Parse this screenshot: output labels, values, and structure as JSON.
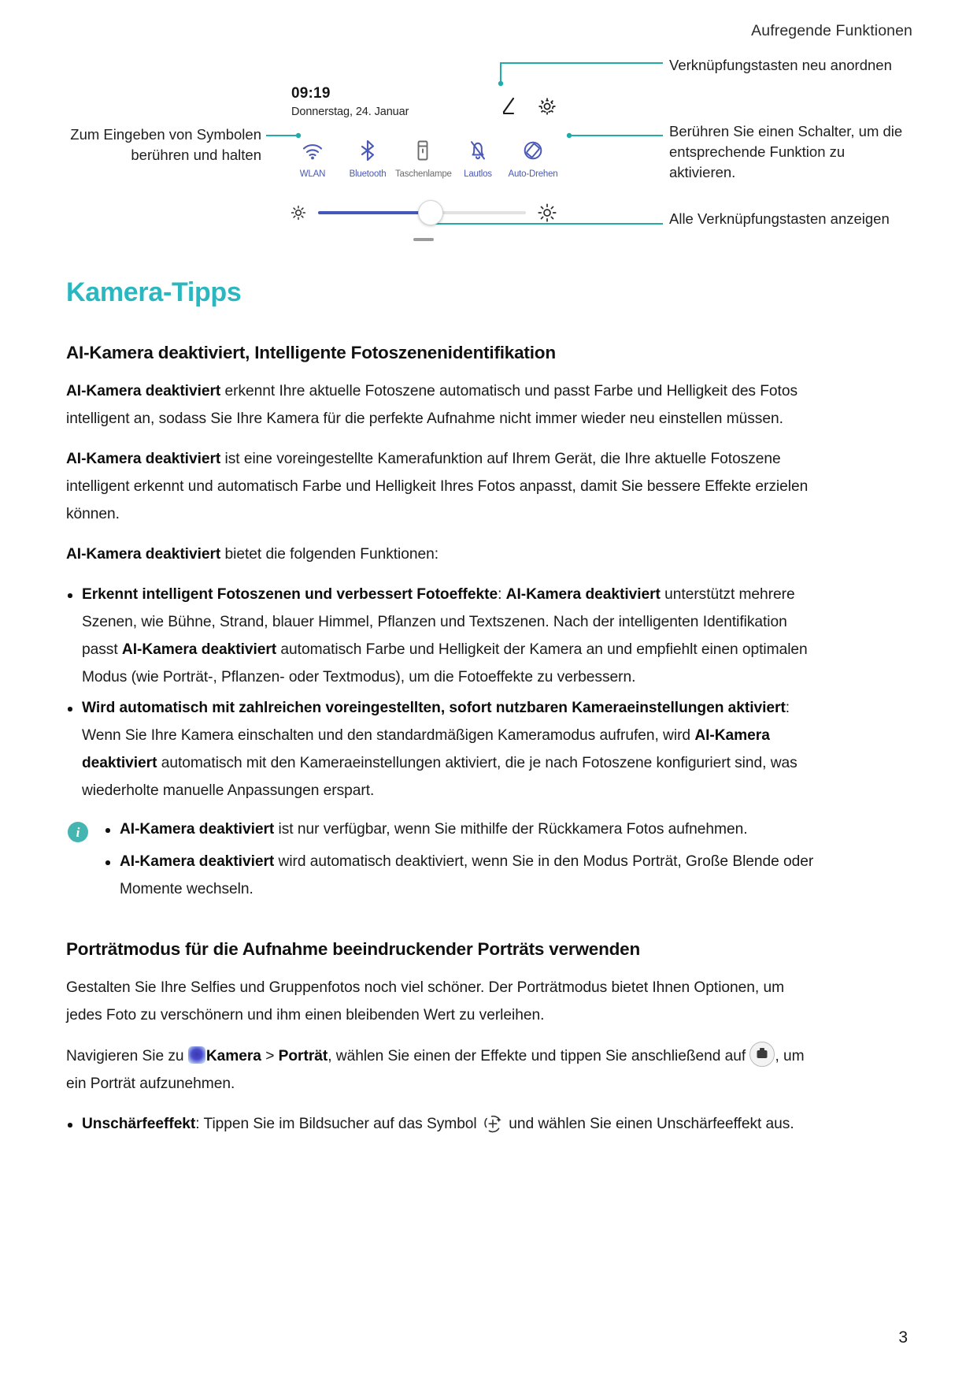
{
  "header": {
    "running_title": "Aufregende Funktionen"
  },
  "figure": {
    "panel": {
      "time": "09:19",
      "date": "Donnerstag, 24. Januar",
      "edit_icon": "pencil-edit-icon",
      "settings_icon": "gear-icon",
      "toggles": [
        {
          "icon": "wifi-icon",
          "label": "WLAN",
          "state": "on"
        },
        {
          "icon": "bluetooth-icon",
          "label": "Bluetooth",
          "state": "on"
        },
        {
          "icon": "flashlight-icon",
          "label": "Taschenlampe",
          "state": "off"
        },
        {
          "icon": "bell-mute-icon",
          "label": "Lautlos",
          "state": "on"
        },
        {
          "icon": "auto-rotate-icon",
          "label": "Auto-Drehen",
          "state": "on"
        }
      ],
      "brightness": {
        "low_icon": "sun-small-icon",
        "high_icon": "sun-large-icon",
        "value_percent": 54
      },
      "expand_handle": "drag-handle"
    },
    "callouts": {
      "left": "Zum Eingeben von Symbolen berühren und halten",
      "right_top": "Verknüpfungstasten neu anordnen",
      "right_middle": "Berühren Sie einen Schalter, um die entsprechende Funktion zu aktivieren.",
      "right_bottom": "Alle Verknüpfungstasten anzeigen"
    }
  },
  "content": {
    "section_title": "Kamera-Tipps",
    "subsection_1": {
      "title": "AI-Kamera deaktiviert, Intelligente Fotoszenenidentifikation",
      "p1_bold": "AI-Kamera deaktiviert",
      "p1_rest": " erkennt Ihre aktuelle Fotoszene automatisch und passt Farbe und Helligkeit des Fotos intelligent an, sodass Sie Ihre Kamera für die perfekte Aufnahme nicht immer wieder neu einstellen müssen.",
      "p2_bold": "AI-Kamera deaktiviert",
      "p2_rest": " ist eine voreingestellte Kamerafunktion auf Ihrem Gerät, die Ihre aktuelle Fotoszene intelligent erkennt und automatisch Farbe und Helligkeit Ihres Fotos anpasst, damit Sie bessere Effekte erzielen können.",
      "p3_bold": "AI-Kamera deaktiviert",
      "p3_rest": " bietet die folgenden Funktionen:",
      "bullet_1": {
        "lead_bold": "Erkennt intelligent Fotoszenen und verbessert Fotoeffekte",
        "colon": ": ",
        "mid_bold_1": "AI-Kamera deaktiviert",
        "text_1": " unterstützt mehrere Szenen, wie Bühne, Strand, blauer Himmel, Pflanzen und Textszenen. Nach der intelligenten Identifikation passt ",
        "mid_bold_2": "AI-Kamera deaktiviert",
        "text_2": " automatisch Farbe und Helligkeit der Kamera an und empfiehlt einen optimalen Modus (wie Porträt-, Pflanzen- oder Textmodus), um die Fotoeffekte zu verbessern."
      },
      "bullet_2": {
        "lead_bold": "Wird automatisch mit zahlreichen voreingestellten, sofort nutzbaren Kameraeinstellungen aktiviert",
        "colon": ": ",
        "text_1": "Wenn Sie Ihre Kamera einschalten und den standardmäßigen Kameramodus aufrufen, wird ",
        "mid_bold_1": "AI-Kamera deaktiviert",
        "text_2": " automatisch mit den Kameraeinstellungen aktiviert, die je nach Fotoszene konfiguriert sind, was wiederholte manuelle Anpassungen erspart."
      },
      "note": {
        "icon": "info-icon",
        "items": [
          {
            "bold": "AI-Kamera deaktiviert",
            "rest": " ist nur verfügbar, wenn Sie mithilfe der Rückkamera Fotos aufnehmen."
          },
          {
            "bold": "AI-Kamera deaktiviert",
            "rest": " wird automatisch deaktiviert, wenn Sie in den Modus Porträt, Große Blende oder Momente wechseln."
          }
        ]
      }
    },
    "subsection_2": {
      "title": "Porträtmodus für die Aufnahme beeindruckender Porträts verwenden",
      "p1": "Gestalten Sie Ihre Selfies und Gruppenfotos noch viel schöner. Der Porträtmodus bietet Ihnen Optionen, um jedes Foto zu verschönern und ihm einen bleibenden Wert zu verleihen.",
      "nav_prefix": "Navigieren Sie zu ",
      "nav_icon": "camera-app-icon",
      "nav_bold_1": "Kamera",
      "nav_sep": " > ",
      "nav_bold_2": "Porträt",
      "nav_mid": ", wählen Sie einen der Effekte und tippen Sie anschließend auf ",
      "nav_shutter_icon": "camera-shutter-icon",
      "nav_suffix": ", um ein Porträt aufzunehmen.",
      "bullet": {
        "lead_bold": "Unschärfeeffekt",
        "colon": ": ",
        "text_1": "Tippen Sie im Bildsucher auf das Symbol ",
        "icon": "aperture-blur-icon",
        "text_2": " und wählen Sie einen Unschärfeeffekt aus."
      }
    }
  },
  "footer": {
    "page_number": "3"
  },
  "colors": {
    "accent_teal": "#2bb7bf",
    "leader_teal": "#20aca8",
    "toggle_blue": "#4a59b5",
    "slider_blue": "#4358b8",
    "info_badge": "#44b5b0"
  }
}
